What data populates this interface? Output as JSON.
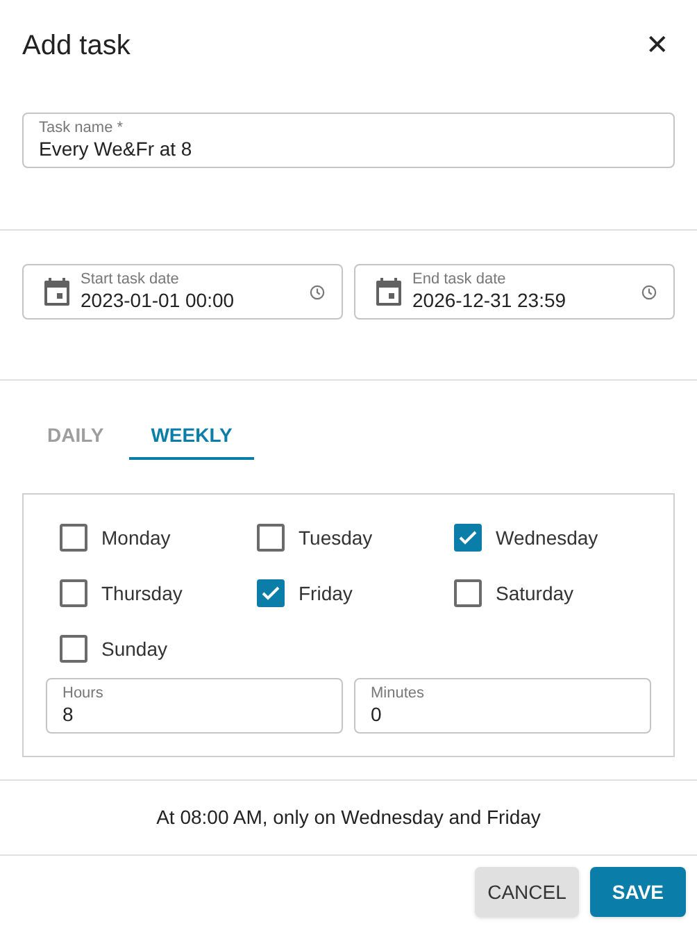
{
  "dialog": {
    "title": "Add task",
    "close": "✕"
  },
  "task_name": {
    "label": "Task name *",
    "value": "Every We&Fr at 8"
  },
  "dates": [
    {
      "label": "Start task date",
      "value": "2023-01-01 00:00"
    },
    {
      "label": "End task date",
      "value": "2026-12-31 23:59"
    }
  ],
  "tabs": [
    {
      "label": "DAILY",
      "selected": false
    },
    {
      "label": "WEEKLY",
      "selected": true
    }
  ],
  "days": [
    {
      "label": "Monday",
      "checked": false
    },
    {
      "label": "Tuesday",
      "checked": false
    },
    {
      "label": "Wednesday",
      "checked": true
    },
    {
      "label": "Thursday",
      "checked": false
    },
    {
      "label": "Friday",
      "checked": true
    },
    {
      "label": "Saturday",
      "checked": false
    },
    {
      "label": "Sunday",
      "checked": false
    }
  ],
  "time": [
    {
      "label": "Hours",
      "value": "8"
    },
    {
      "label": "Minutes",
      "value": "0"
    }
  ],
  "summary": "At 08:00 AM, only on Wednesday and Friday",
  "buttons": [
    {
      "label": "CANCEL",
      "kind": "secondary"
    },
    {
      "label": "SAVE",
      "kind": "primary"
    }
  ]
}
